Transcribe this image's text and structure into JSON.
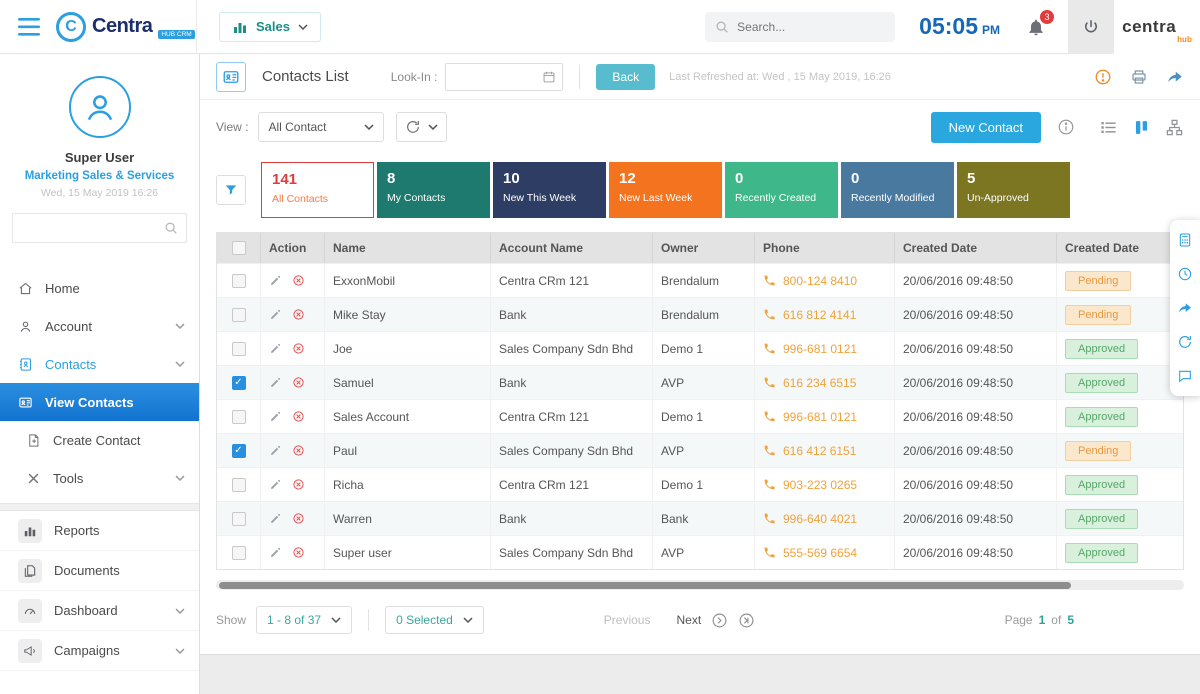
{
  "palette": {
    "accent_blue": "#2ba7e0",
    "active_nav_blue": "#1273cf",
    "red": "#e23b3b",
    "phone_orange": "#efa23c",
    "pending_text": "#e59a43",
    "approved_text": "#55a868"
  },
  "header": {
    "brand_name": "Centra",
    "brand_badge": "HUB CRM",
    "module_label": "Sales",
    "search_placeholder": "Search...",
    "time": "05:05",
    "meridiem": "PM",
    "notification_count": "3",
    "brand_right": "centra",
    "brand_right_accent": "hub"
  },
  "sidebar": {
    "user_name": "Super User",
    "user_role": "Marketing Sales & Services",
    "user_date": "Wed, 15 May 2019 16:26",
    "nav": [
      {
        "label": "Home"
      },
      {
        "label": "Account"
      },
      {
        "label": "Contacts"
      },
      {
        "label": "View Contacts"
      },
      {
        "label": "Create Contact"
      },
      {
        "label": "Tools"
      },
      {
        "label": "Reports"
      },
      {
        "label": "Documents"
      },
      {
        "label": "Dashboard"
      },
      {
        "label": "Campaigns"
      }
    ]
  },
  "toolbar": {
    "title": "Contacts List",
    "lookin_label": "Look-In :",
    "lookin_value": "",
    "back_label": "Back",
    "last_refreshed": "Last Refreshed at: Wed , 15 May 2019, 16:26"
  },
  "viewbar": {
    "view_label": "View :",
    "view_value": "All Contact",
    "new_contact_label": "New Contact"
  },
  "stats": [
    {
      "value": "141",
      "label": "All Contacts",
      "color": "#ffffff"
    },
    {
      "value": "8",
      "label": "My Contacts",
      "color": "#1e7a6f"
    },
    {
      "value": "10",
      "label": "New This Week",
      "color": "#2e3d64"
    },
    {
      "value": "12",
      "label": "New Last Week",
      "color": "#f4731f"
    },
    {
      "value": "0",
      "label": "Recently Created",
      "color": "#3eb88a"
    },
    {
      "value": "0",
      "label": "Recently Modified",
      "color": "#49799f"
    },
    {
      "value": "5",
      "label": "Un-Approved",
      "color": "#7c7623"
    }
  ],
  "table": {
    "columns": [
      "Action",
      "Name",
      "Account Name",
      "Owner",
      "Phone",
      "Created Date",
      "Created Date"
    ],
    "rows": [
      {
        "name": "ExxonMobil",
        "account": "Centra CRm 121",
        "owner": "Brendalum",
        "phone": "800-124 8410",
        "created": "20/06/2016 09:48:50",
        "status": "Pending",
        "checked": false
      },
      {
        "name": "Mike Stay",
        "account": "Bank",
        "owner": "Brendalum",
        "phone": "616 812 4141",
        "created": "20/06/2016 09:48:50",
        "status": "Pending",
        "checked": false
      },
      {
        "name": "Joe",
        "account": "Sales Company Sdn Bhd",
        "owner": "Demo 1",
        "phone": "996-681 0121",
        "created": "20/06/2016 09:48:50",
        "status": "Approved",
        "checked": false
      },
      {
        "name": "Samuel",
        "account": "Bank",
        "owner": "AVP",
        "phone": "616 234 6515",
        "created": "20/06/2016 09:48:50",
        "status": "Approved",
        "checked": true
      },
      {
        "name": "Sales Account",
        "account": "Centra CRm 121",
        "owner": "Demo 1",
        "phone": "996-681 0121",
        "created": "20/06/2016 09:48:50",
        "status": "Approved",
        "checked": false
      },
      {
        "name": "Paul",
        "account": "Sales Company Sdn Bhd",
        "owner": "AVP",
        "phone": "616 412 6151",
        "created": "20/06/2016 09:48:50",
        "status": "Pending",
        "checked": true
      },
      {
        "name": "Richa",
        "account": "Centra CRm 121",
        "owner": "Demo 1",
        "phone": "903-223 0265",
        "created": "20/06/2016 09:48:50",
        "status": "Approved",
        "checked": false
      },
      {
        "name": "Warren",
        "account": "Bank",
        "owner": "Bank",
        "phone": "996-640 4021",
        "created": "20/06/2016 09:48:50",
        "status": "Approved",
        "checked": false
      },
      {
        "name": "Super user",
        "account": "Sales Company Sdn Bhd",
        "owner": "AVP",
        "phone": "555-569 6654",
        "created": "20/06/2016 09:48:50",
        "status": "Approved",
        "checked": false
      }
    ]
  },
  "footer": {
    "show_label": "Show",
    "range_value": "1 - 8 of 37",
    "selected_value": "0 Selected",
    "previous_label": "Previous",
    "next_label": "Next",
    "page_label": "Page",
    "page_current": "1",
    "page_of": "of",
    "page_total": "5"
  }
}
